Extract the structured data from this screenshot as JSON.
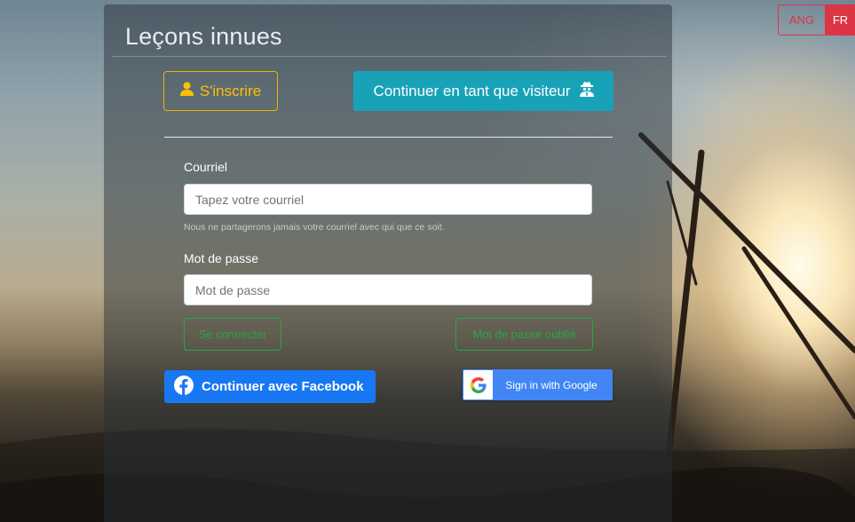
{
  "app": {
    "title": "Leçons innues"
  },
  "actions": {
    "register_label": "S'inscrire",
    "visitor_label": "Continuer en tant que visiteur"
  },
  "form": {
    "email_label": "Courriel",
    "email_placeholder": "Tapez votre courriel",
    "email_help": "Nous ne partagerons jamais votre courriel avec qui que ce soit.",
    "password_label": "Mot de passe",
    "password_placeholder": "Mot de passe",
    "login_label": "Se connecter",
    "forgot_label": "Mot de passe oublié"
  },
  "social": {
    "facebook_label": "Continuer avec Facebook",
    "google_label": "Sign in with Google"
  },
  "language": {
    "options": [
      "ANG",
      "FR"
    ],
    "selected": "FR"
  },
  "icons": {
    "register": "user-icon",
    "visitor": "user-secret-icon",
    "facebook": "facebook-icon",
    "google": "google-icon"
  },
  "colors": {
    "warning": "#ffc107",
    "info": "#17a2b8",
    "success": "#28a745",
    "danger": "#dc3545",
    "facebook": "#1877f2",
    "google": "#4285f4"
  }
}
